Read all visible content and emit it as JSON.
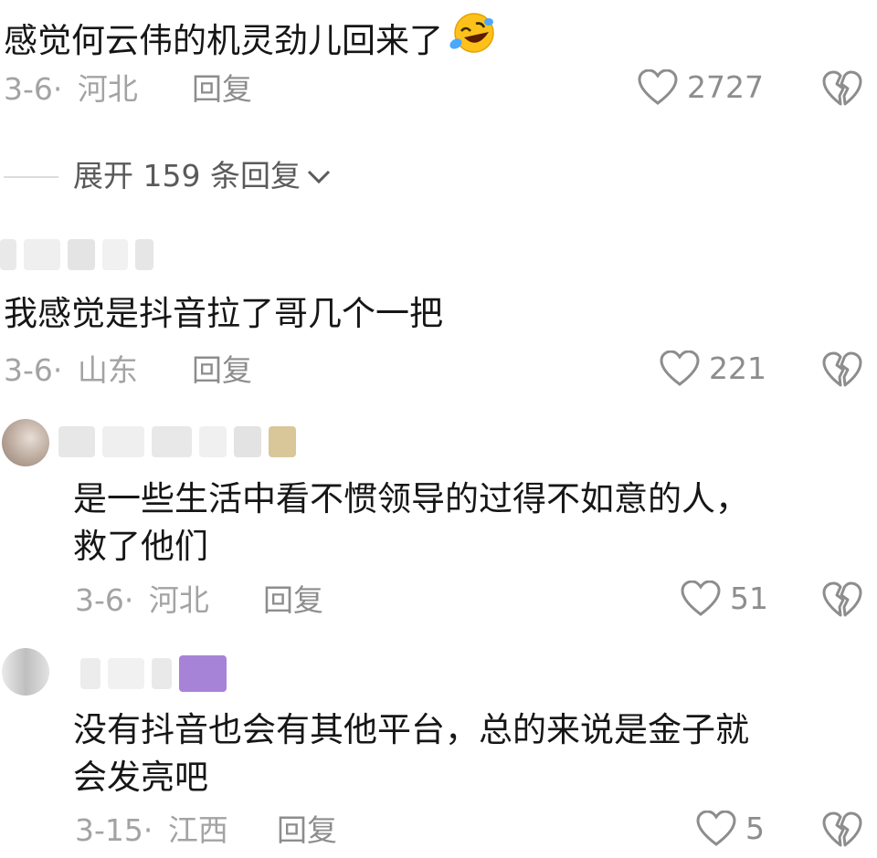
{
  "comments": [
    {
      "text": "感觉何云伟的机灵劲儿回来了",
      "emoji": "😂",
      "date": "3-6·",
      "location": "河北",
      "reply_label": "回复",
      "likes": "2727"
    },
    {
      "text": "我感觉是抖音拉了哥几个一把",
      "date": "3-6·",
      "location": "山东",
      "reply_label": "回复",
      "likes": "221"
    },
    {
      "text_line1": "是一些生活中看不惯领导的过得不如意的人，",
      "text_line2": "救了他们",
      "date": "3-6·",
      "location": "河北",
      "reply_label": "回复",
      "likes": "51"
    },
    {
      "text_line1": "没有抖音也会有其他平台，总的来说是金子就",
      "text_line2": "会发亮吧",
      "date": "3-15·",
      "location": "江西",
      "reply_label": "回复",
      "likes": "5"
    }
  ],
  "expand_replies": {
    "label": "展开 159 条回复"
  },
  "icons": {
    "like": "heart-outline-icon",
    "dislike": "broken-heart-icon",
    "expand": "chevron-down-icon"
  },
  "colors": {
    "meta_gray": "#a3a3a3",
    "action_gray": "#8d8d8d",
    "text_dark": "#161616"
  }
}
